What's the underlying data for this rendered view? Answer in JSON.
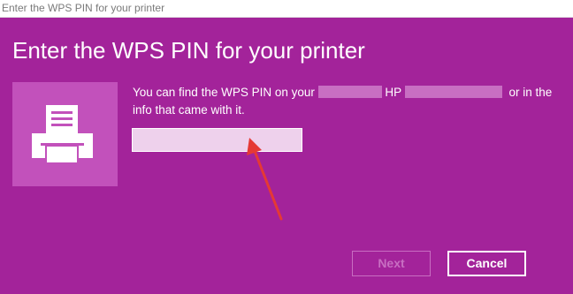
{
  "window": {
    "title": "Enter the WPS PIN for your printer"
  },
  "dialog": {
    "heading": "Enter the WPS PIN for your printer",
    "icon": "printer-icon",
    "message": {
      "part1": "You can find the WPS PIN on your",
      "part2": "HP",
      "part3": "or in the info that came with it."
    },
    "pin_input": {
      "value": "",
      "placeholder": ""
    },
    "annotation": "red-arrow-pointing-to-pin-input"
  },
  "buttons": {
    "next_label": "Next",
    "next_enabled": false,
    "cancel_label": "Cancel"
  },
  "colors": {
    "background": "#a3239a",
    "tile": "#c251bb",
    "text": "#ffffff",
    "disabled": "#c86ec2",
    "arrow": "#e53935"
  }
}
